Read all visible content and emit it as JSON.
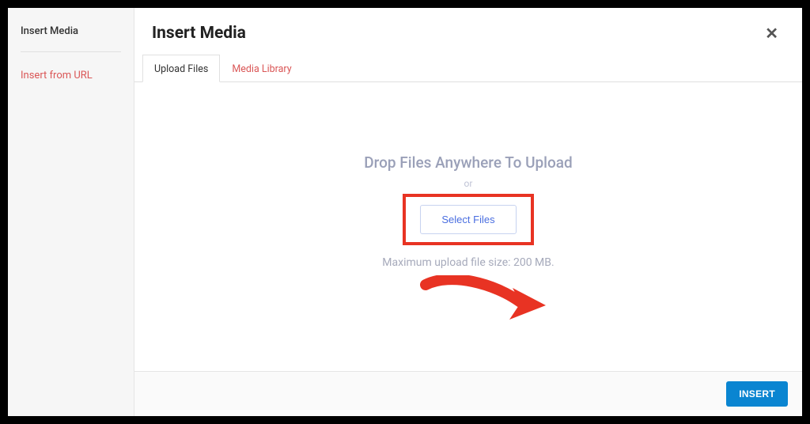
{
  "sidebar": {
    "title": "Insert Media",
    "link": "Insert from URL"
  },
  "header": {
    "title": "Insert Media"
  },
  "tabs": {
    "upload": "Upload Files",
    "library": "Media Library"
  },
  "upload": {
    "drop_text": "Drop Files Anywhere To Upload",
    "or_text": "or",
    "select_label": "Select Files",
    "max_text": "Maximum upload file size: 200 MB."
  },
  "footer": {
    "insert_label": "INSERT"
  },
  "annotation": {
    "arrow_color": "#e83323"
  }
}
